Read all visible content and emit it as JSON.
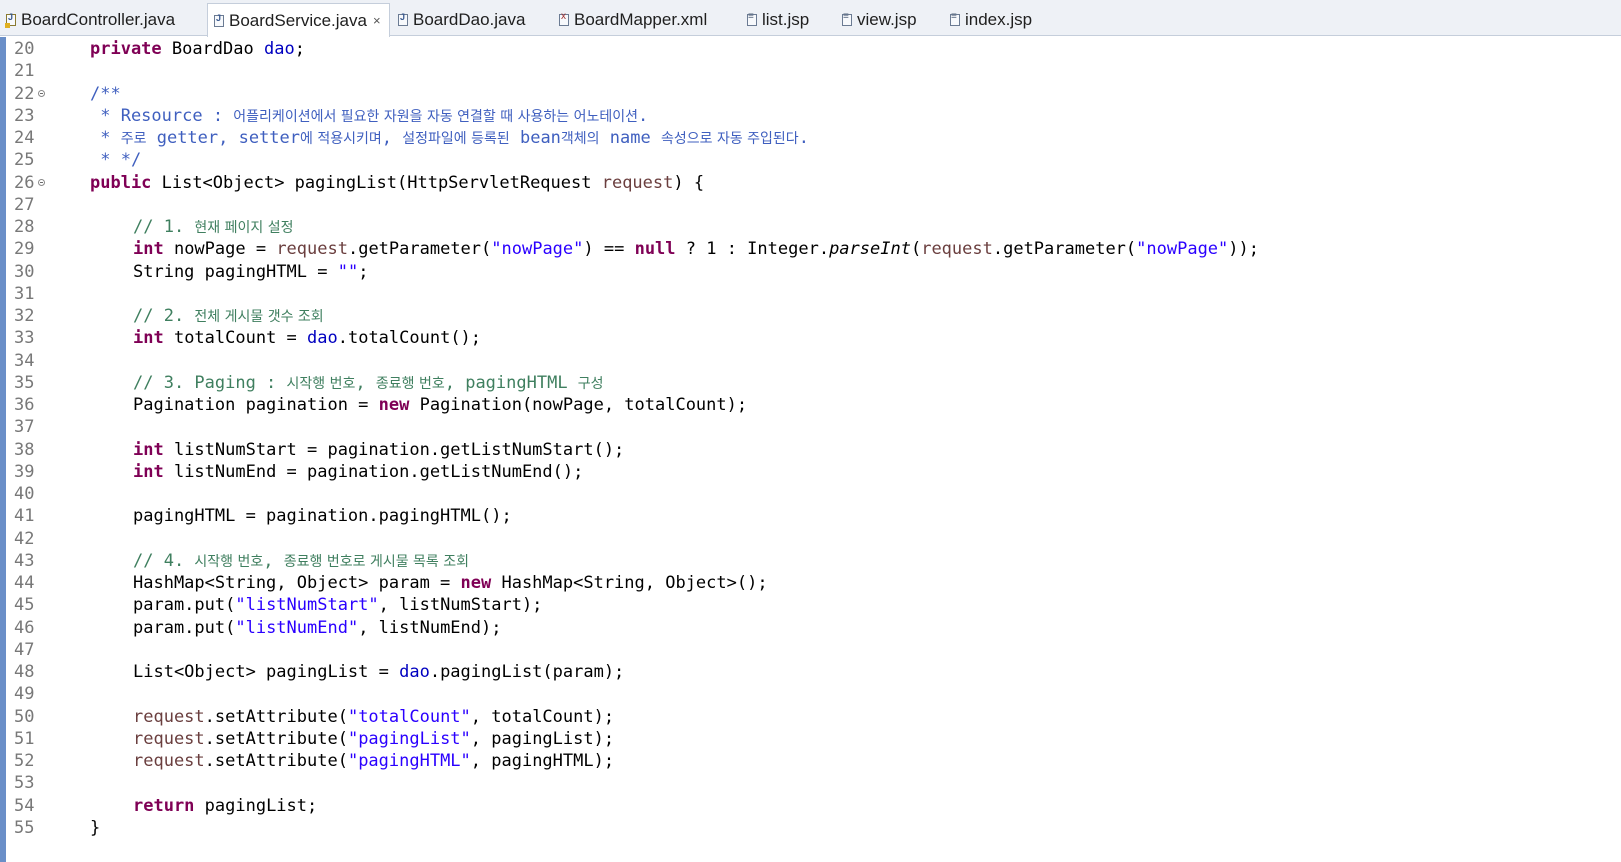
{
  "tabs": [
    {
      "label": "BoardController.java",
      "icon": "java-file-warning-icon"
    },
    {
      "label": "BoardService.java",
      "icon": "java-file-icon",
      "active": true,
      "close": "×"
    },
    {
      "label": "BoardDao.java",
      "icon": "java-file-icon"
    },
    {
      "label": "BoardMapper.xml",
      "icon": "xml-file-icon"
    },
    {
      "label": "list.jsp",
      "icon": "jsp-file-icon"
    },
    {
      "label": "view.jsp",
      "icon": "jsp-file-icon"
    },
    {
      "label": "index.jsp",
      "icon": "jsp-file-icon"
    }
  ],
  "editor": {
    "colors": {
      "keyword": "#7f0055",
      "field": "#0000c0",
      "string": "#2a00ff",
      "comment": "#3f7f5f",
      "javadoc": "#3f5fbf",
      "parameter": "#6a3e3e"
    },
    "lines": [
      {
        "num": "20"
      },
      {
        "num": "21"
      },
      {
        "num": "22",
        "fold": true
      },
      {
        "num": "23"
      },
      {
        "num": "24"
      },
      {
        "num": "25"
      },
      {
        "num": "26",
        "fold": true
      },
      {
        "num": "27"
      },
      {
        "num": "28"
      },
      {
        "num": "29"
      },
      {
        "num": "30"
      },
      {
        "num": "31"
      },
      {
        "num": "32"
      },
      {
        "num": "33"
      },
      {
        "num": "34"
      },
      {
        "num": "35"
      },
      {
        "num": "36"
      },
      {
        "num": "37"
      },
      {
        "num": "38"
      },
      {
        "num": "39"
      },
      {
        "num": "40"
      },
      {
        "num": "41"
      },
      {
        "num": "42"
      },
      {
        "num": "43"
      },
      {
        "num": "44"
      },
      {
        "num": "45"
      },
      {
        "num": "46"
      },
      {
        "num": "47"
      },
      {
        "num": "48"
      },
      {
        "num": "49"
      },
      {
        "num": "50"
      },
      {
        "num": "51"
      },
      {
        "num": "52"
      },
      {
        "num": "53"
      },
      {
        "num": "54"
      },
      {
        "num": "55"
      }
    ],
    "code": [
      {
        "indent": 0,
        "tokens": [
          [
            "kw",
            "private"
          ],
          [
            "",
            "BoardDao "
          ],
          [
            "fld",
            "dao"
          ],
          [
            "",
            ";"
          ]
        ]
      },
      {
        "indent": 0,
        "tokens": []
      },
      {
        "indent": 0,
        "tokens": [
          [
            "jd",
            "/**"
          ]
        ]
      },
      {
        "indent": 0,
        "tokens": [
          [
            "jd",
            " * Resource : "
          ],
          [
            "jd ko",
            "어플리케이션에서 필요한 자원을 자동 연결할 때 사용하는 어노테이션"
          ],
          [
            "jd",
            "."
          ]
        ]
      },
      {
        "indent": 0,
        "tokens": [
          [
            "jd",
            " * "
          ],
          [
            "jd ko",
            "주로"
          ],
          [
            "jd",
            " getter, setter"
          ],
          [
            "jd ko",
            "에 적용시키며"
          ],
          [
            "jd",
            ", "
          ],
          [
            "jd ko",
            "설정파일에 등록된"
          ],
          [
            "jd",
            " bean"
          ],
          [
            "jd ko",
            "객체의"
          ],
          [
            "jd",
            " name "
          ],
          [
            "jd ko",
            "속성으로 자동 주입된다"
          ],
          [
            "jd",
            "."
          ]
        ]
      },
      {
        "indent": 0,
        "tokens": [
          [
            "jd",
            " * */"
          ]
        ]
      },
      {
        "indent": 0,
        "tokens": [
          [
            "kw",
            "public"
          ],
          [
            "",
            "List<Object> pagingList(HttpServletRequest "
          ],
          [
            "prm",
            "request"
          ],
          [
            "",
            ") {"
          ]
        ]
      },
      {
        "indent": 1,
        "tokens": []
      },
      {
        "indent": 1,
        "tokens": [
          [
            "cm",
            "// 1. "
          ],
          [
            "cm ko",
            "현재 페이지 설정"
          ]
        ]
      },
      {
        "indent": 1,
        "tokens": [
          [
            "kw",
            "int"
          ],
          [
            "",
            " nowPage = "
          ],
          [
            "prm",
            "request"
          ],
          [
            "",
            ".getParameter("
          ],
          [
            "str",
            "\"nowPage\""
          ],
          [
            "",
            ") == "
          ],
          [
            "kw",
            "null"
          ],
          [
            "",
            " ? 1 : Integer."
          ],
          [
            "it",
            "parseInt"
          ],
          [
            "",
            "("
          ],
          [
            "prm",
            "request"
          ],
          [
            "",
            ".getParameter("
          ],
          [
            "str",
            "\"nowPage\""
          ],
          [
            "",
            "));"
          ]
        ]
      },
      {
        "indent": 1,
        "tokens": [
          [
            "",
            "String pagingHTML = "
          ],
          [
            "str",
            "\"\""
          ],
          [
            "",
            ";"
          ]
        ]
      },
      {
        "indent": 1,
        "tokens": []
      },
      {
        "indent": 1,
        "tokens": [
          [
            "cm",
            "// 2. "
          ],
          [
            "cm ko",
            "전체 게시물 갯수 조회"
          ]
        ]
      },
      {
        "indent": 1,
        "tokens": [
          [
            "kw",
            "int"
          ],
          [
            "",
            " totalCount = "
          ],
          [
            "fld",
            "dao"
          ],
          [
            "",
            ".totalCount();"
          ]
        ]
      },
      {
        "indent": 1,
        "tokens": []
      },
      {
        "indent": 1,
        "tokens": [
          [
            "cm",
            "// 3. Paging : "
          ],
          [
            "cm ko",
            "시작행 번호"
          ],
          [
            "cm",
            ", "
          ],
          [
            "cm ko",
            "종료행 번호"
          ],
          [
            "cm",
            ", pagingHTML "
          ],
          [
            "cm ko",
            "구성"
          ]
        ]
      },
      {
        "indent": 1,
        "tokens": [
          [
            "",
            "Pagination pagination = "
          ],
          [
            "kw",
            "new"
          ],
          [
            "",
            " Pagination(nowPage, totalCount);"
          ]
        ]
      },
      {
        "indent": 1,
        "tokens": []
      },
      {
        "indent": 1,
        "tokens": [
          [
            "kw",
            "int"
          ],
          [
            "",
            " listNumStart = pagination.getListNumStart();"
          ]
        ]
      },
      {
        "indent": 1,
        "tokens": [
          [
            "kw",
            "int"
          ],
          [
            "",
            " listNumEnd = pagination.getListNumEnd();"
          ]
        ]
      },
      {
        "indent": 1,
        "tokens": []
      },
      {
        "indent": 1,
        "tokens": [
          [
            "",
            "pagingHTML = pagination.pagingHTML();"
          ]
        ]
      },
      {
        "indent": 1,
        "tokens": []
      },
      {
        "indent": 1,
        "tokens": [
          [
            "cm",
            "// 4. "
          ],
          [
            "cm ko",
            "시작행 번호"
          ],
          [
            "cm",
            ", "
          ],
          [
            "cm ko",
            "종료행 번호로 게시물 목록 조회"
          ]
        ]
      },
      {
        "indent": 1,
        "tokens": [
          [
            "",
            "HashMap<String, Object> param = "
          ],
          [
            "kw",
            "new"
          ],
          [
            "",
            " HashMap<String, Object>();"
          ]
        ]
      },
      {
        "indent": 1,
        "tokens": [
          [
            "",
            "param.put("
          ],
          [
            "str",
            "\"listNumStart\""
          ],
          [
            "",
            ", listNumStart);"
          ]
        ]
      },
      {
        "indent": 1,
        "tokens": [
          [
            "",
            "param.put("
          ],
          [
            "str",
            "\"listNumEnd\""
          ],
          [
            "",
            ", listNumEnd);"
          ]
        ]
      },
      {
        "indent": 1,
        "tokens": []
      },
      {
        "indent": 1,
        "tokens": [
          [
            "",
            "List<Object> pagingList = "
          ],
          [
            "fld",
            "dao"
          ],
          [
            "",
            ".pagingList(param);"
          ]
        ]
      },
      {
        "indent": 1,
        "tokens": []
      },
      {
        "indent": 1,
        "tokens": [
          [
            "prm",
            "request"
          ],
          [
            "",
            ".setAttribute("
          ],
          [
            "str",
            "\"totalCount\""
          ],
          [
            "",
            ", totalCount);"
          ]
        ]
      },
      {
        "indent": 1,
        "tokens": [
          [
            "prm",
            "request"
          ],
          [
            "",
            ".setAttribute("
          ],
          [
            "str",
            "\"pagingList\""
          ],
          [
            "",
            ", pagingList);"
          ]
        ]
      },
      {
        "indent": 1,
        "tokens": [
          [
            "prm",
            "request"
          ],
          [
            "",
            ".setAttribute("
          ],
          [
            "str",
            "\"pagingHTML\""
          ],
          [
            "",
            ", pagingHTML);"
          ]
        ]
      },
      {
        "indent": 1,
        "tokens": []
      },
      {
        "indent": 1,
        "tokens": [
          [
            "kw",
            "return"
          ],
          [
            "",
            " pagingList;"
          ]
        ]
      },
      {
        "indent": 0,
        "tokens": [
          [
            "",
            "}"
          ]
        ]
      }
    ]
  }
}
